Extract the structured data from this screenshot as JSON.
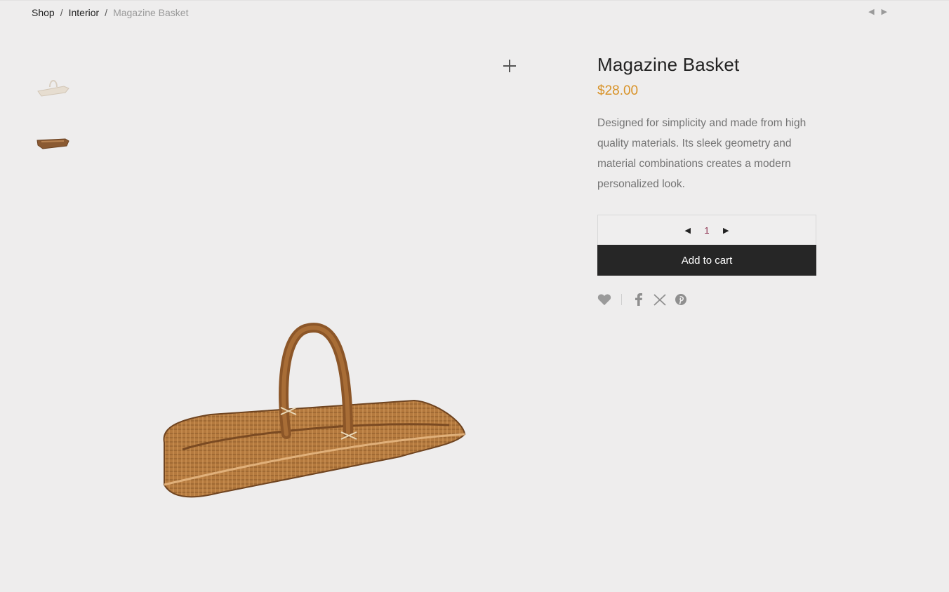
{
  "breadcrumb": {
    "items": [
      "Shop",
      "Interior"
    ],
    "separator": "/",
    "current": "Magazine Basket"
  },
  "product_nav": {
    "prev": "◀",
    "next": "▶"
  },
  "product": {
    "title": "Magazine Basket",
    "price": "$28.00",
    "description": "Designed for simplicity and made from high quality materials. Its sleek geometry and material combinations creates a modern personalized look."
  },
  "quantity": {
    "decrease": "◀",
    "value": "1",
    "increase": "▶"
  },
  "cart": {
    "label": "Add to cart"
  },
  "colors": {
    "price": "#d89227",
    "button_bg": "#262626",
    "background": "#eeeded"
  },
  "icons": {
    "zoom": "plus-icon",
    "wishlist": "heart-icon",
    "share": [
      "facebook-icon",
      "x-icon",
      "pinterest-icon"
    ]
  }
}
